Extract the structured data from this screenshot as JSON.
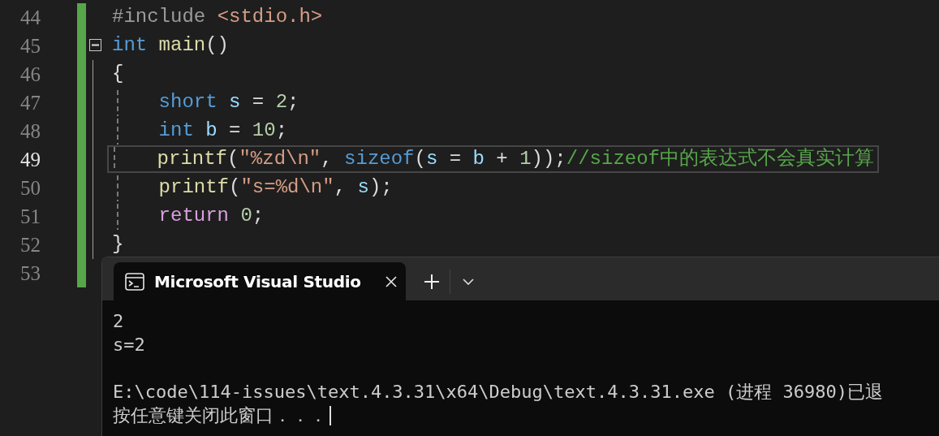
{
  "editor": {
    "lines": [
      {
        "number": "44",
        "current": false,
        "changed": true,
        "tokens": [
          {
            "kind": "preprocessor",
            "text": "#include "
          },
          {
            "kind": "string",
            "text": "<stdio.h>"
          }
        ]
      },
      {
        "number": "45",
        "current": false,
        "changed": true,
        "fold": {
          "expanded": true
        },
        "tokens": [
          {
            "kind": "keyword",
            "text": "int "
          },
          {
            "kind": "function",
            "text": "main"
          },
          {
            "kind": "plain",
            "text": "()"
          }
        ]
      },
      {
        "number": "46",
        "current": false,
        "changed": true,
        "tokens": [
          {
            "kind": "plain",
            "text": "{"
          }
        ]
      },
      {
        "number": "47",
        "current": false,
        "changed": true,
        "tokens": [
          {
            "kind": "keyword",
            "text": "    short "
          },
          {
            "kind": "variable",
            "text": "s"
          },
          {
            "kind": "plain",
            "text": " = "
          },
          {
            "kind": "number",
            "text": "2"
          },
          {
            "kind": "plain",
            "text": ";"
          }
        ]
      },
      {
        "number": "48",
        "current": false,
        "changed": true,
        "tokens": [
          {
            "kind": "keyword",
            "text": "    int "
          },
          {
            "kind": "variable",
            "text": "b"
          },
          {
            "kind": "plain",
            "text": " = "
          },
          {
            "kind": "number",
            "text": "10"
          },
          {
            "kind": "plain",
            "text": ";"
          }
        ]
      },
      {
        "number": "49",
        "current": true,
        "changed": true,
        "tokens": [
          {
            "kind": "function",
            "text": "    printf"
          },
          {
            "kind": "plain",
            "text": "("
          },
          {
            "kind": "string",
            "text": "\"%zd\\n\""
          },
          {
            "kind": "plain",
            "text": ", "
          },
          {
            "kind": "keyword",
            "text": "sizeof"
          },
          {
            "kind": "plain",
            "text": "("
          },
          {
            "kind": "variable",
            "text": "s"
          },
          {
            "kind": "plain",
            "text": " = "
          },
          {
            "kind": "variable",
            "text": "b"
          },
          {
            "kind": "plain",
            "text": " + "
          },
          {
            "kind": "number",
            "text": "1"
          },
          {
            "kind": "plain",
            "text": "));"
          },
          {
            "kind": "comment",
            "text": "//sizeof中的表达式不会真实计算"
          }
        ]
      },
      {
        "number": "50",
        "current": false,
        "changed": true,
        "tokens": [
          {
            "kind": "function",
            "text": "    printf"
          },
          {
            "kind": "plain",
            "text": "("
          },
          {
            "kind": "string",
            "text": "\"s=%d\\n\""
          },
          {
            "kind": "plain",
            "text": ", "
          },
          {
            "kind": "variable",
            "text": "s"
          },
          {
            "kind": "plain",
            "text": ");"
          }
        ]
      },
      {
        "number": "51",
        "current": false,
        "changed": true,
        "tokens": [
          {
            "kind": "control",
            "text": "    return "
          },
          {
            "kind": "number",
            "text": "0"
          },
          {
            "kind": "plain",
            "text": ";"
          }
        ]
      },
      {
        "number": "52",
        "current": false,
        "changed": true,
        "tokens": [
          {
            "kind": "plain",
            "text": "}"
          }
        ]
      },
      {
        "number": "53",
        "current": false,
        "changed": true
      }
    ]
  },
  "terminal": {
    "tab": {
      "title": "Microsoft Visual Studio"
    },
    "output_groups": [
      [
        "2",
        "s=2"
      ],
      [
        "E:\\code\\114-issues\\text.4.3.31\\x64\\Debug\\text.4.3.31.exe (进程 36980)已退",
        "按任意键关闭此窗口．．．"
      ]
    ]
  }
}
